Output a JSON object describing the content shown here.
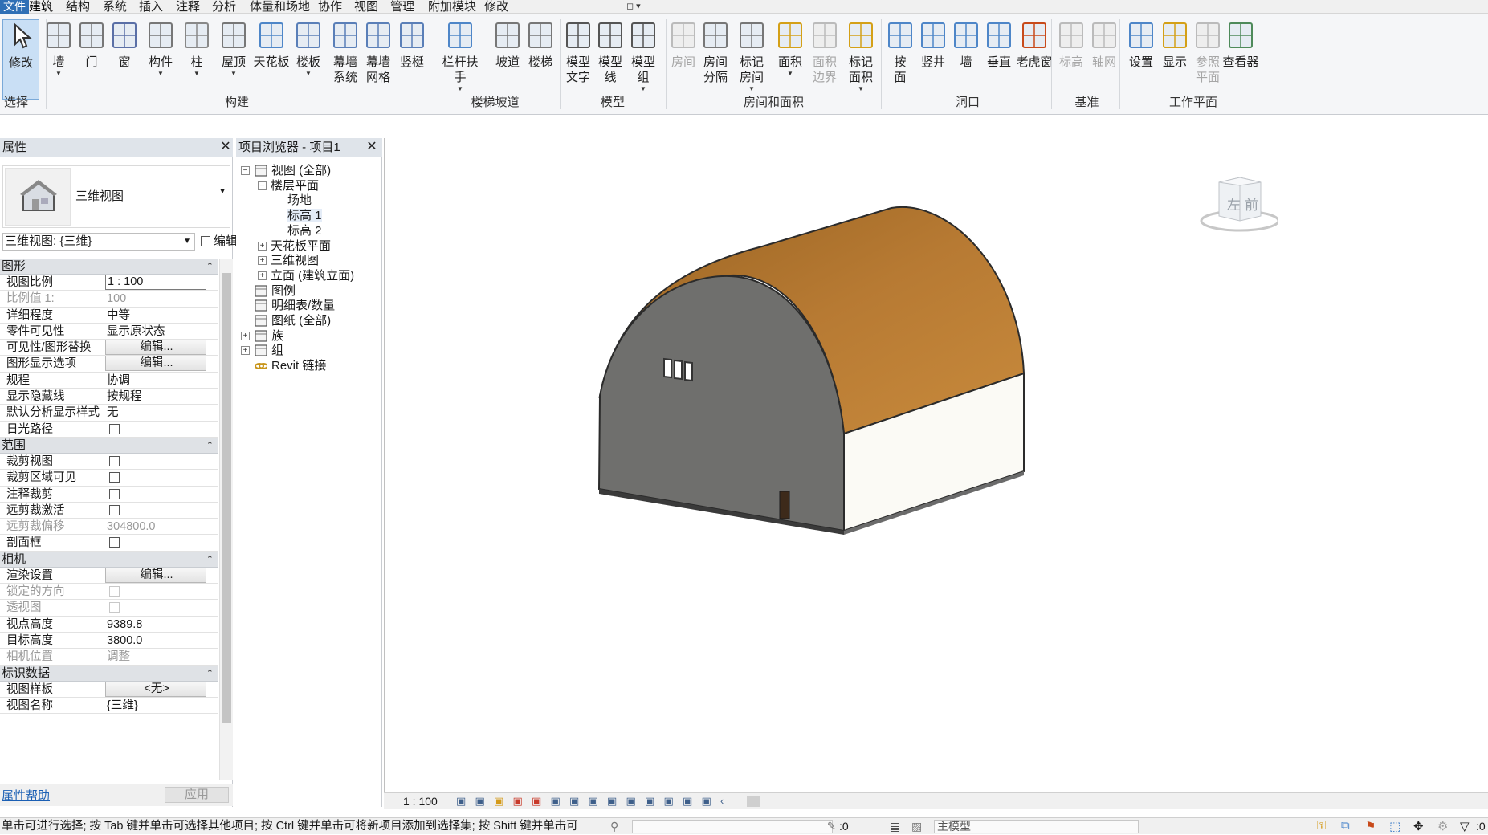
{
  "menu": {
    "file": "文件",
    "tabs": [
      "建筑",
      "结构",
      "系统",
      "插入",
      "注释",
      "分析",
      "体量和场地",
      "协作",
      "视图",
      "管理",
      "附加模块",
      "修改"
    ],
    "active_tab": "建筑"
  },
  "ribbon": {
    "buttons": [
      {
        "label": "修改",
        "icon": "cursor-icon",
        "active": true
      },
      {
        "label": "墙",
        "icon": "wall-icon",
        "drop": true
      },
      {
        "label": "门",
        "icon": "door-icon"
      },
      {
        "label": "窗",
        "icon": "window-icon"
      },
      {
        "label": "构件",
        "icon": "component-icon",
        "drop": true
      },
      {
        "label": "柱",
        "icon": "column-icon",
        "drop": true
      },
      {
        "label": "屋顶",
        "icon": "roof-icon",
        "drop": true
      },
      {
        "label": "天花板",
        "icon": "ceiling-icon"
      },
      {
        "label": "楼板",
        "icon": "floor-icon",
        "drop": true
      },
      {
        "label": "幕墙\n系统",
        "icon": "curtain-system-icon"
      },
      {
        "label": "幕墙\n网格",
        "icon": "curtain-grid-icon"
      },
      {
        "label": "竖梃",
        "icon": "mullion-icon"
      },
      {
        "label": "栏杆扶手",
        "icon": "railing-icon",
        "drop": true
      },
      {
        "label": "坡道",
        "icon": "ramp-icon"
      },
      {
        "label": "楼梯",
        "icon": "stair-icon"
      },
      {
        "label": "模型\n文字",
        "icon": "model-text-icon"
      },
      {
        "label": "模型\n线",
        "icon": "model-line-icon"
      },
      {
        "label": "模型\n组",
        "icon": "model-group-icon",
        "drop": true
      },
      {
        "label": "房间",
        "icon": "room-icon",
        "disabled": true
      },
      {
        "label": "房间\n分隔",
        "icon": "room-separator-icon"
      },
      {
        "label": "标记\n房间",
        "icon": "tag-room-icon",
        "drop": true
      },
      {
        "label": "面积",
        "icon": "area-icon",
        "drop": true
      },
      {
        "label": "面积\n边界",
        "icon": "area-boundary-icon",
        "disabled": true
      },
      {
        "label": "标记\n面积",
        "icon": "tag-area-icon",
        "drop": true
      },
      {
        "label": "按\n面",
        "icon": "by-face-icon"
      },
      {
        "label": "竖井",
        "icon": "shaft-icon"
      },
      {
        "label": "墙",
        "icon": "wall-opening-icon"
      },
      {
        "label": "垂直",
        "icon": "vertical-opening-icon"
      },
      {
        "label": "老虎窗",
        "icon": "dormer-icon"
      },
      {
        "label": "标高",
        "icon": "level-icon",
        "disabled": true
      },
      {
        "label": "轴网",
        "icon": "grid-icon",
        "disabled": true
      },
      {
        "label": "设置",
        "icon": "set-workplane-icon"
      },
      {
        "label": "显示",
        "icon": "show-workplane-icon"
      },
      {
        "label": "参照\n平面",
        "icon": "ref-plane-icon",
        "disabled": true
      },
      {
        "label": "查看器",
        "icon": "viewer-icon"
      }
    ],
    "panels": [
      "选择",
      "构建",
      "楼梯坡道",
      "模型",
      "房间和面积",
      "洞口",
      "基准",
      "工作平面"
    ]
  },
  "properties": {
    "title": "属性",
    "type_name": "三维视图",
    "view_selector": "三维视图: {三维}",
    "edit_type": "编辑类型",
    "sections": [
      {
        "title": "图形",
        "rows": [
          {
            "k": "视图比例",
            "v": "1 : 100",
            "kind": "input"
          },
          {
            "k": "比例值 1:",
            "v": "100",
            "disabled": true
          },
          {
            "k": "详细程度",
            "v": "中等"
          },
          {
            "k": "零件可见性",
            "v": "显示原状态"
          },
          {
            "k": "可见性/图形替换",
            "v": "编辑...",
            "kind": "btn"
          },
          {
            "k": "图形显示选项",
            "v": "编辑...",
            "kind": "btn"
          },
          {
            "k": "规程",
            "v": "协调"
          },
          {
            "k": "显示隐藏线",
            "v": "按规程"
          },
          {
            "k": "默认分析显示样式",
            "v": "无"
          },
          {
            "k": "日光路径",
            "kind": "check"
          }
        ]
      },
      {
        "title": "范围",
        "rows": [
          {
            "k": "裁剪视图",
            "kind": "check"
          },
          {
            "k": "裁剪区域可见",
            "kind": "check"
          },
          {
            "k": "注释裁剪",
            "kind": "check"
          },
          {
            "k": "远剪裁激活",
            "kind": "check"
          },
          {
            "k": "远剪裁偏移",
            "v": "304800.0",
            "disabled": true
          },
          {
            "k": "剖面框",
            "kind": "check"
          }
        ]
      },
      {
        "title": "相机",
        "rows": [
          {
            "k": "渲染设置",
            "v": "编辑...",
            "kind": "btn"
          },
          {
            "k": "锁定的方向",
            "kind": "check",
            "disabled": true
          },
          {
            "k": "透视图",
            "kind": "check",
            "disabled": true
          },
          {
            "k": "视点高度",
            "v": "9389.8"
          },
          {
            "k": "目标高度",
            "v": "3800.0"
          },
          {
            "k": "相机位置",
            "v": "调整",
            "disabled": true
          }
        ]
      },
      {
        "title": "标识数据",
        "rows": [
          {
            "k": "视图样板",
            "v": "<无>",
            "kind": "btn"
          },
          {
            "k": "视图名称",
            "v": "{三维}"
          }
        ]
      }
    ],
    "help": "属性帮助",
    "apply": "应用"
  },
  "browser": {
    "title": "项目浏览器 - 项目1",
    "items": [
      {
        "label": "视图 (全部)",
        "level": 0,
        "exp": "−",
        "icon": "views-icon"
      },
      {
        "label": "楼层平面",
        "level": 1,
        "exp": "−"
      },
      {
        "label": "场地",
        "level": 2
      },
      {
        "label": "标高 1",
        "level": 2,
        "selected": true
      },
      {
        "label": "标高 2",
        "level": 2
      },
      {
        "label": "天花板平面",
        "level": 1,
        "exp": "+"
      },
      {
        "label": "三维视图",
        "level": 1,
        "exp": "+"
      },
      {
        "label": "立面 (建筑立面)",
        "level": 1,
        "exp": "+"
      },
      {
        "label": "图例",
        "level": 0,
        "icon": "legend-icon"
      },
      {
        "label": "明细表/数量",
        "level": 0,
        "icon": "schedule-icon"
      },
      {
        "label": "图纸 (全部)",
        "level": 0,
        "icon": "sheet-icon"
      },
      {
        "label": "族",
        "level": 0,
        "exp": "+",
        "icon": "family-icon"
      },
      {
        "label": "组",
        "level": 0,
        "exp": "+",
        "icon": "group-icon"
      },
      {
        "label": "Revit 链接",
        "level": 0,
        "icon": "link-icon"
      }
    ]
  },
  "viewport": {
    "scale": "1 : 100",
    "viewcube": {
      "left": "左",
      "front": "前"
    }
  },
  "status": {
    "text": "单击可进行选择; 按 Tab 键并单击可选择其他项目; 按 Ctrl 键并单击可将新项目添加到选择集; 按 Shift 键并单击可",
    "sel_count": ":0",
    "model": "主模型",
    "filter_count": ":0"
  }
}
